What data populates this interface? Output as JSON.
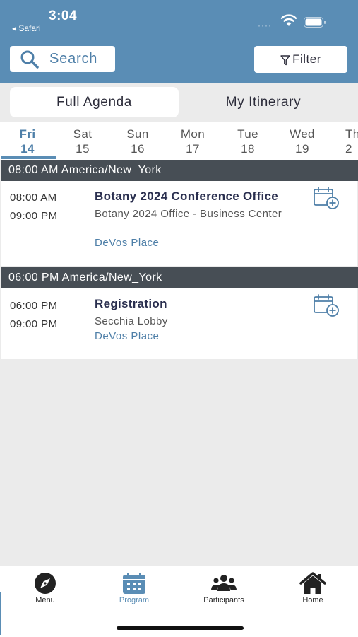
{
  "status_bar": {
    "time": "3:04",
    "back_app": "◂ Safari",
    "signal": "····"
  },
  "header": {
    "search_label": "Search",
    "filter_label": "Filter"
  },
  "segments": {
    "full_agenda": "Full Agenda",
    "my_itinerary": "My Itinerary"
  },
  "days": [
    {
      "name": "Fri",
      "num": "14",
      "active": true
    },
    {
      "name": "Sat",
      "num": "15"
    },
    {
      "name": "Sun",
      "num": "16"
    },
    {
      "name": "Mon",
      "num": "17"
    },
    {
      "name": "Tue",
      "num": "18"
    },
    {
      "name": "Wed",
      "num": "19"
    },
    {
      "name": "Th",
      "num": "2"
    }
  ],
  "sections": [
    {
      "header": "08:00 AM America/New_York",
      "event": {
        "start": "08:00 AM",
        "end": "09:00 PM",
        "title": "Botany 2024 Conference Office",
        "location": "Botany 2024 Office - Business Center",
        "venue": "DeVos Place"
      }
    },
    {
      "header": "06:00 PM America/New_York",
      "event": {
        "start": "06:00 PM",
        "end": "09:00 PM",
        "title": "Registration",
        "location": "Secchia Lobby",
        "venue": "DeVos Place"
      }
    }
  ],
  "tabbar": {
    "menu": "Menu",
    "program": "Program",
    "participants": "Participants",
    "home": "Home"
  },
  "colors": {
    "brand_blue": "#5a8db5",
    "link_blue": "#4e7fa8",
    "section_header": "#474e55"
  },
  "icons": {
    "search": "magnifier-icon",
    "filter": "funnel-icon",
    "add_to_calendar": "calendar-plus-icon",
    "menu": "compass-icon",
    "program": "calendar-icon",
    "participants": "people-icon",
    "home": "house-icon"
  }
}
